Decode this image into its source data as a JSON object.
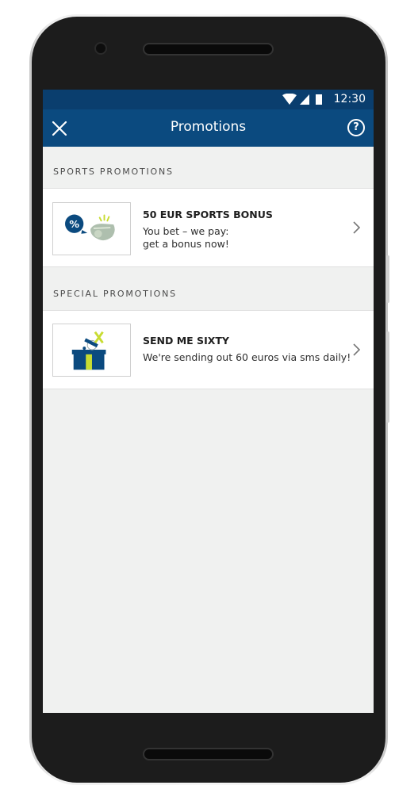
{
  "status_bar": {
    "time": "12:30",
    "icons": [
      "wifi-icon",
      "signal-icon",
      "battery-icon"
    ],
    "background": "#0a3e6e"
  },
  "app_bar": {
    "title": "Promotions",
    "close_icon": "close-icon",
    "help_label": "?",
    "background": "#0b4a7f"
  },
  "sections": [
    {
      "header": "SPORTS PROMOTIONS",
      "items": [
        {
          "title": "50 EUR SPORTS BONUS",
          "description_lines": [
            "You bet – we pay:",
            "get a bonus now!"
          ],
          "thumb_icon": "percent-whistle-icon"
        }
      ]
    },
    {
      "header": "SPECIAL PROMOTIONS",
      "items": [
        {
          "title": "SEND ME SIXTY",
          "description_lines": [
            "We're sending out 60 euros via sms daily!"
          ],
          "thumb_icon": "gift-box-icon"
        }
      ]
    }
  ],
  "colors": {
    "accent_blue": "#0b4a7f",
    "accent_lime": "#c8dc32",
    "screen_bg": "#f0f1f0"
  }
}
